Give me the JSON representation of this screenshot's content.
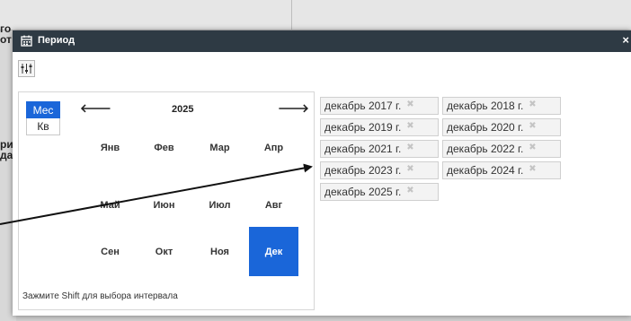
{
  "background": {
    "fragments": [
      "го",
      "от",
      "ри",
      "да"
    ]
  },
  "modal": {
    "title": "Период",
    "close_label": "×",
    "icons": {
      "calendar": "calendar-icon",
      "toolbar": "sort-filter-icon",
      "prev": "arrow-left-icon",
      "next": "arrow-right-icon",
      "tag_remove": "close-icon"
    },
    "mode_buttons": [
      "Мес",
      "Кв"
    ],
    "active_mode": "Мес",
    "year": "2025",
    "nav_prev": "🡐",
    "nav_next": "🡒",
    "months": [
      "Янв",
      "Фев",
      "Мар",
      "Апр",
      "Май",
      "Июн",
      "Июл",
      "Авг",
      "Сен",
      "Окт",
      "Ноя",
      "Дек"
    ],
    "selected_month": "Дек",
    "hint": "Зажмите Shift для выбора интервала",
    "selected_periods": [
      "декабрь 2017 г.",
      "декабрь 2018 г.",
      "декабрь 2019 г.",
      "декабрь 2020 г.",
      "декабрь 2021 г.",
      "декабрь 2022 г.",
      "декабрь 2023 г.",
      "декабрь 2024 г.",
      "декабрь 2025 г."
    ],
    "tag_remove": "✖"
  },
  "colors": {
    "header": "#2e3a44",
    "accent": "#1a66d9"
  }
}
